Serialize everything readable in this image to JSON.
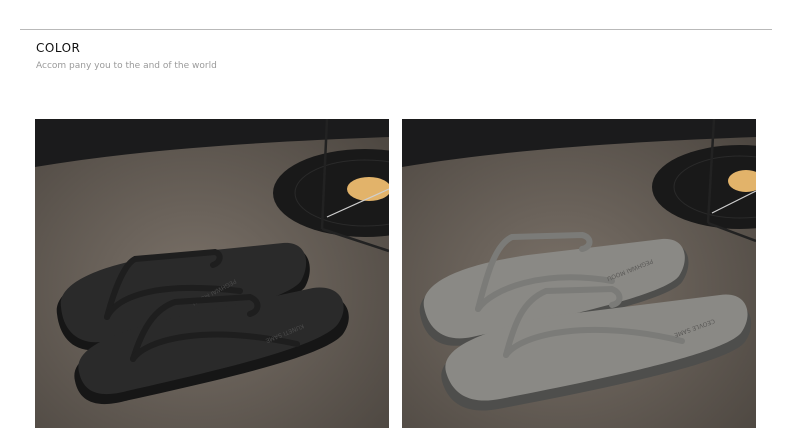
{
  "section": {
    "title": "COLOR",
    "subtitle": "Accom pany you to the and of the world"
  },
  "products": [
    {
      "color_name": "black",
      "sole_color": "#2a2a2a",
      "strap_color": "#1e1e1e",
      "sole_imprint": [
        "PEGHWAI MOOU",
        "KUNETI SAME"
      ]
    },
    {
      "color_name": "grey",
      "sole_color": "#8a8985",
      "strap_color": "#7b7b78",
      "sole_imprint": [
        "PEGHWAI MOOU",
        "CEOVLE SAME"
      ]
    }
  ],
  "colors": {
    "floor": "#6a625a",
    "backdrop": "#1b1b1c",
    "record": "#191919",
    "record_label": "#e2b36a"
  }
}
